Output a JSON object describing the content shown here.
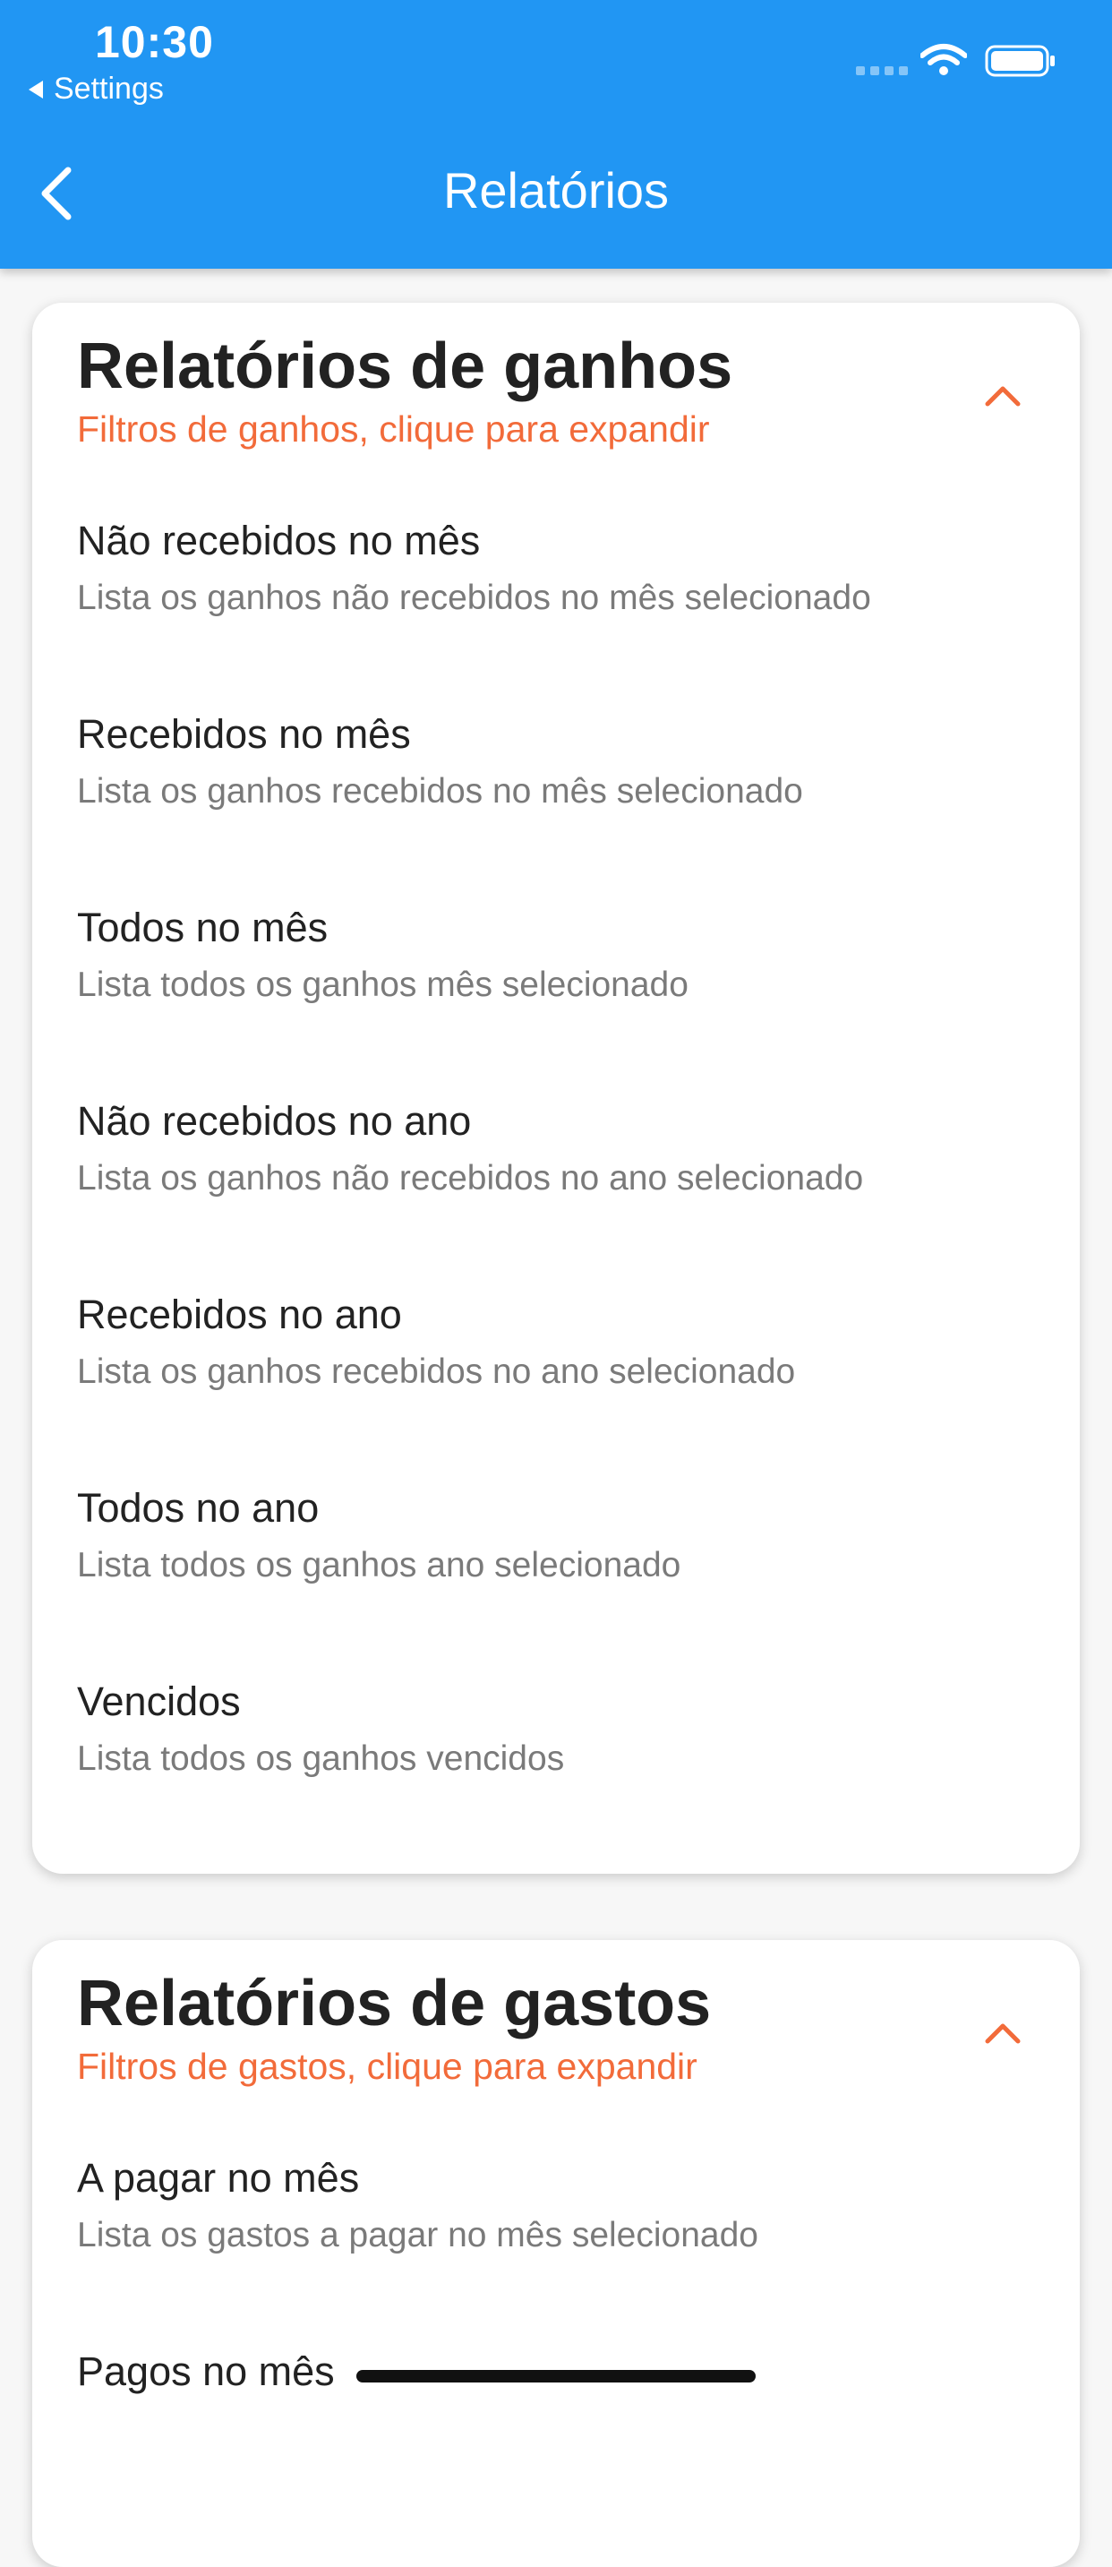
{
  "status_bar": {
    "time": "10:30",
    "back_label": "Settings"
  },
  "nav": {
    "title": "Relatórios"
  },
  "colors": {
    "primary": "#2196F3",
    "accent": "#F26B3A"
  },
  "icons": {
    "back": "chevron-left-icon",
    "expand": "chevron-up-icon",
    "wifi": "wifi-icon",
    "battery": "battery-icon"
  },
  "sections": [
    {
      "title": "Relatórios de ganhos",
      "subtitle": "Filtros de ganhos, clique para expandir",
      "items": [
        {
          "title": "Não recebidos no mês",
          "subtitle": "Lista os ganhos não recebidos no mês selecionado"
        },
        {
          "title": "Recebidos no mês",
          "subtitle": "Lista os ganhos recebidos no mês selecionado"
        },
        {
          "title": "Todos no mês",
          "subtitle": "Lista todos os ganhos mês selecionado"
        },
        {
          "title": "Não recebidos no ano",
          "subtitle": "Lista os ganhos não recebidos no ano selecionado"
        },
        {
          "title": "Recebidos no ano",
          "subtitle": "Lista os ganhos recebidos no ano selecionado"
        },
        {
          "title": "Todos no ano",
          "subtitle": "Lista todos os ganhos ano selecionado"
        },
        {
          "title": "Vencidos",
          "subtitle": "Lista todos os ganhos vencidos"
        }
      ]
    },
    {
      "title": "Relatórios de gastos",
      "subtitle": "Filtros de gastos, clique para expandir",
      "items": [
        {
          "title": "A pagar no mês",
          "subtitle": "Lista os gastos a pagar no mês selecionado"
        },
        {
          "title": "Pagos no mês",
          "subtitle": ""
        }
      ]
    }
  ]
}
